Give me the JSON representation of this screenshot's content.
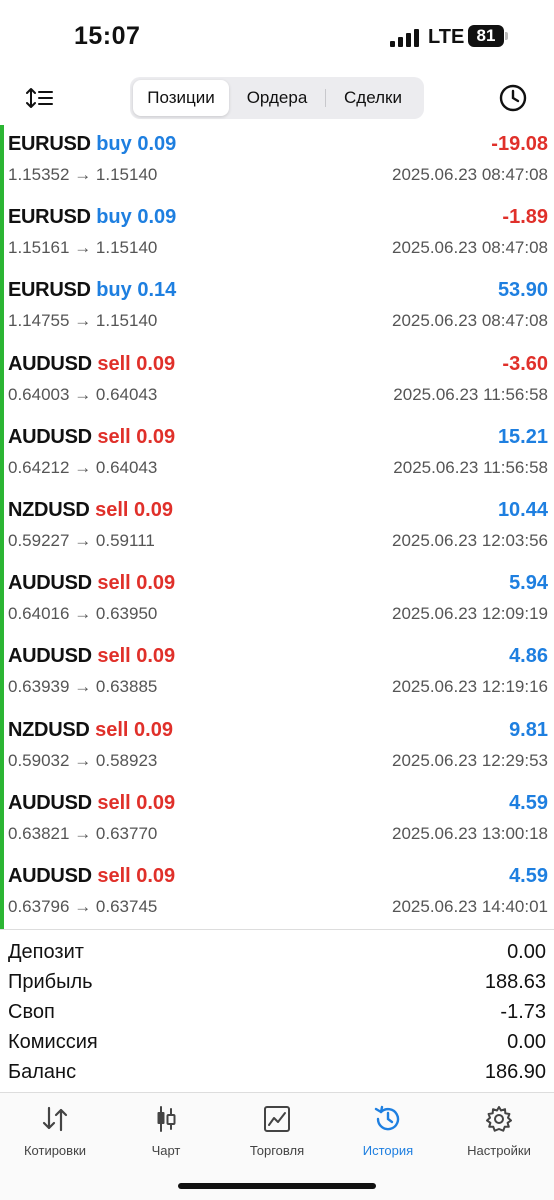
{
  "status": {
    "time": "15:07",
    "network": "LTE",
    "battery": "81"
  },
  "toolbar": {
    "sort_icon": "sort-icon",
    "tabs": [
      "Позиции",
      "Ордера",
      "Сделки"
    ],
    "active_tab": 0,
    "history_icon": "clock-icon"
  },
  "deals": [
    {
      "symbol": "EURUSD",
      "direction": "buy",
      "volume": "0.09",
      "open": "1.15352",
      "close": "1.15140",
      "time": "2025.06.23 08:47:08",
      "profit": "-19.08",
      "negative": true
    },
    {
      "symbol": "EURUSD",
      "direction": "buy",
      "volume": "0.09",
      "open": "1.15161",
      "close": "1.15140",
      "time": "2025.06.23 08:47:08",
      "profit": "-1.89",
      "negative": true
    },
    {
      "symbol": "EURUSD",
      "direction": "buy",
      "volume": "0.14",
      "open": "1.14755",
      "close": "1.15140",
      "time": "2025.06.23 08:47:08",
      "profit": "53.90",
      "negative": false
    },
    {
      "symbol": "AUDUSD",
      "direction": "sell",
      "volume": "0.09",
      "open": "0.64003",
      "close": "0.64043",
      "time": "2025.06.23 11:56:58",
      "profit": "-3.60",
      "negative": true
    },
    {
      "symbol": "AUDUSD",
      "direction": "sell",
      "volume": "0.09",
      "open": "0.64212",
      "close": "0.64043",
      "time": "2025.06.23 11:56:58",
      "profit": "15.21",
      "negative": false
    },
    {
      "symbol": "NZDUSD",
      "direction": "sell",
      "volume": "0.09",
      "open": "0.59227",
      "close": "0.59111",
      "time": "2025.06.23 12:03:56",
      "profit": "10.44",
      "negative": false
    },
    {
      "symbol": "AUDUSD",
      "direction": "sell",
      "volume": "0.09",
      "open": "0.64016",
      "close": "0.63950",
      "time": "2025.06.23 12:09:19",
      "profit": "5.94",
      "negative": false
    },
    {
      "symbol": "AUDUSD",
      "direction": "sell",
      "volume": "0.09",
      "open": "0.63939",
      "close": "0.63885",
      "time": "2025.06.23 12:19:16",
      "profit": "4.86",
      "negative": false
    },
    {
      "symbol": "NZDUSD",
      "direction": "sell",
      "volume": "0.09",
      "open": "0.59032",
      "close": "0.58923",
      "time": "2025.06.23 12:29:53",
      "profit": "9.81",
      "negative": false
    },
    {
      "symbol": "AUDUSD",
      "direction": "sell",
      "volume": "0.09",
      "open": "0.63821",
      "close": "0.63770",
      "time": "2025.06.23 13:00:18",
      "profit": "4.59",
      "negative": false
    },
    {
      "symbol": "AUDUSD",
      "direction": "sell",
      "volume": "0.09",
      "open": "0.63796",
      "close": "0.63745",
      "time": "2025.06.23 14:40:01",
      "profit": "4.59",
      "negative": false
    }
  ],
  "arrow": "→",
  "summary": [
    {
      "label": "Депозит",
      "value": "0.00"
    },
    {
      "label": "Прибыль",
      "value": "188.63"
    },
    {
      "label": "Своп",
      "value": "-1.73"
    },
    {
      "label": "Комиссия",
      "value": "0.00"
    },
    {
      "label": "Баланс",
      "value": "186.90"
    }
  ],
  "tabbar": [
    {
      "label": "Котировки",
      "icon": "quotes-icon"
    },
    {
      "label": "Чарт",
      "icon": "candles-icon"
    },
    {
      "label": "Торговля",
      "icon": "trade-chart-icon"
    },
    {
      "label": "История",
      "icon": "history-clock-icon",
      "active": true
    },
    {
      "label": "Настройки",
      "icon": "gear-icon"
    }
  ],
  "colors": {
    "buy": "#1e7fe0",
    "sell": "#e0302a",
    "accent": "#1e7fe0",
    "position_bar": "#2bb533"
  }
}
